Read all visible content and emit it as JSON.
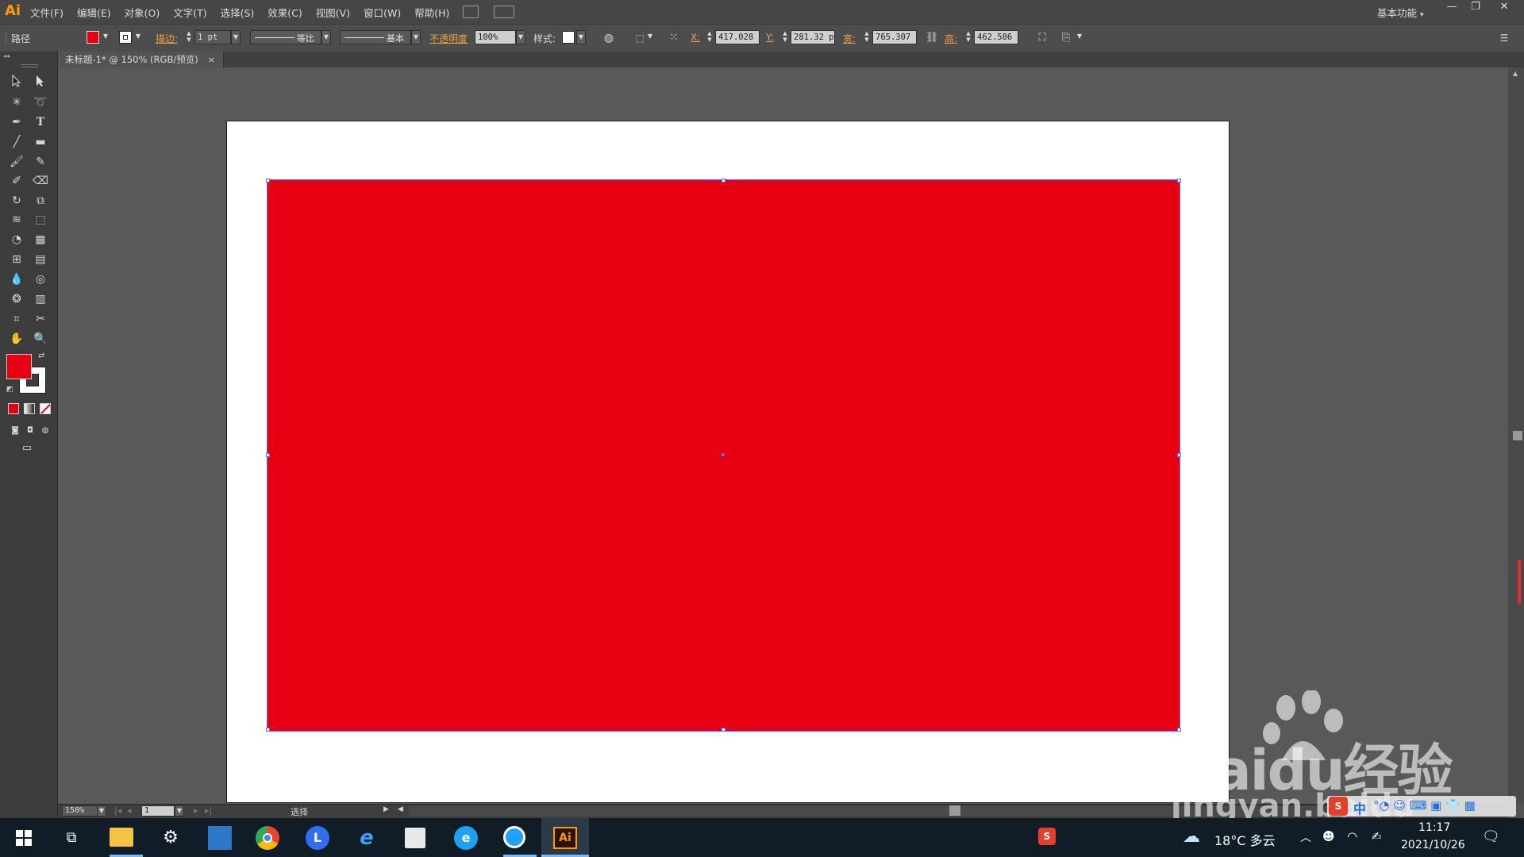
{
  "app": {
    "logo": "Ai",
    "menu": [
      "文件(F)",
      "编辑(E)",
      "对象(O)",
      "文字(T)",
      "选择(S)",
      "效果(C)",
      "视图(V)",
      "窗口(W)",
      "帮助(H)"
    ],
    "workspace": "基本功能",
    "window_controls": [
      "—",
      "❐",
      "✕"
    ]
  },
  "control_bar": {
    "object_type": "路径",
    "stroke_label": "描边:",
    "stroke_weight": "1 pt",
    "profile_label": "等比",
    "brush_label": "基本",
    "opacity_label": "不透明度",
    "opacity_value": "100%",
    "style_label": "样式:",
    "x_label": "X:",
    "x_value": "417.028",
    "y_label": "Y:",
    "y_value": "281.32 p",
    "w_label": "宽:",
    "w_value": "765.307",
    "h_label": "高:",
    "h_value": "462.586"
  },
  "document": {
    "tab_title": "未标题-1* @ 150% (RGB/预览)",
    "tab_close": "×"
  },
  "colors": {
    "fill": "#e60012",
    "stroke": "#ffffff",
    "selection": "#5a6cff",
    "accent": "#f0a040"
  },
  "tools": [
    "selection-tool-icon",
    "direct-selection-tool-icon",
    "magic-wand-icon",
    "lasso-icon",
    "pen-tool-icon",
    "type-tool-icon",
    "line-tool-icon",
    "rectangle-tool-icon",
    "paintbrush-icon",
    "pencil-icon",
    "blob-brush-icon",
    "eraser-icon",
    "rotate-icon",
    "scale-icon",
    "warp-icon",
    "free-transform-icon",
    "shape-builder-icon",
    "perspective-grid-icon",
    "mesh-icon",
    "gradient-icon",
    "eyedropper-icon",
    "blend-icon",
    "symbol-sprayer-icon",
    "column-graph-icon",
    "artboard-icon",
    "slice-icon",
    "hand-icon",
    "zoom-icon"
  ],
  "status_bar": {
    "zoom": "150%",
    "page": "1",
    "tool": "选择"
  },
  "watermark": {
    "main": "Baidu经验",
    "sub": "jingyan.baidu"
  },
  "taskbar": {
    "weather": "18°C 多云",
    "time": "11:17",
    "date": "2021/10/26",
    "ime": "中",
    "ai_label": "Ai"
  }
}
